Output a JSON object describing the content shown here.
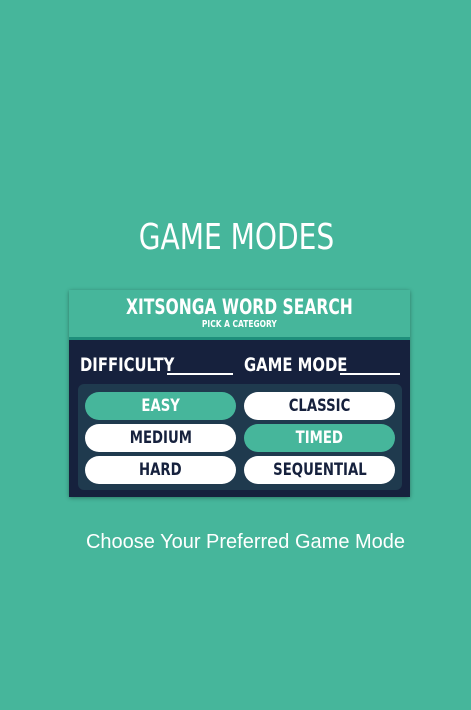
{
  "screen": {
    "title": "GAME MODES",
    "caption": "Choose Your Preferred Game Mode"
  },
  "card": {
    "title": "XITSONGA WORD SEARCH",
    "subtitle": "PICK A CATEGORY"
  },
  "difficulty": {
    "heading": "DIFFICULTY",
    "options": [
      {
        "label": "EASY",
        "selected": true
      },
      {
        "label": "MEDIUM",
        "selected": false
      },
      {
        "label": "HARD",
        "selected": false
      }
    ]
  },
  "game_mode": {
    "heading": "GAME MODE",
    "options": [
      {
        "label": "CLASSIC",
        "selected": false
      },
      {
        "label": "TIMED",
        "selected": true
      },
      {
        "label": "SEQUENTIAL",
        "selected": false
      }
    ]
  },
  "colors": {
    "background": "#46b69b",
    "card_body": "#16213d",
    "options_panel": "#1f3a4e",
    "selected_option": "#46b69b",
    "unselected_option": "#ffffff"
  }
}
